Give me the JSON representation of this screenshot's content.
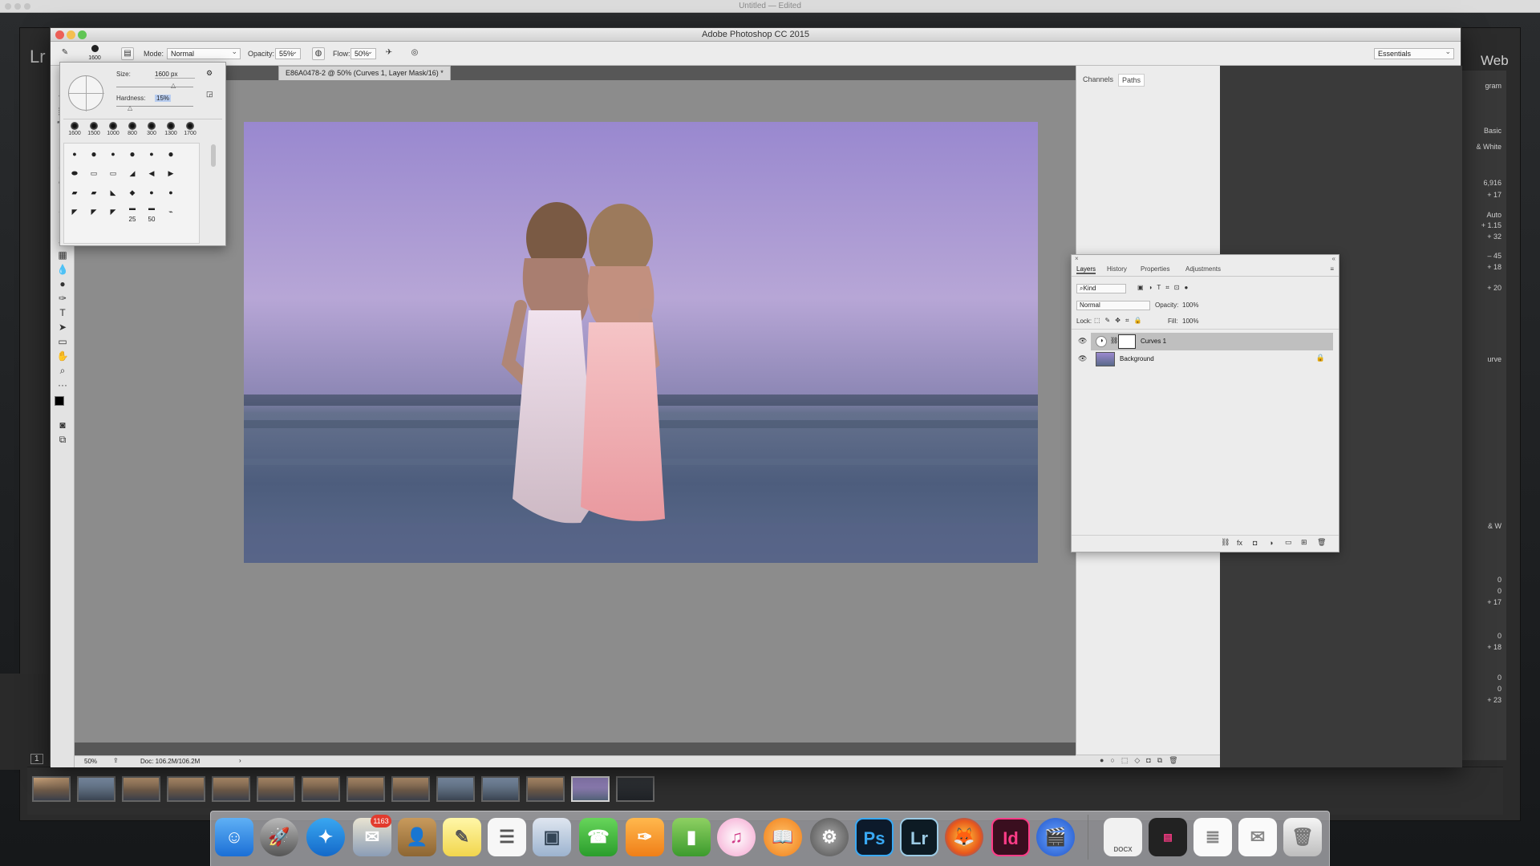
{
  "desktop": {
    "top_title": "Untitled — Edited"
  },
  "lightroom": {
    "logo": "Lr",
    "module_web": "Web",
    "right_values": [
      "6,916",
      "+ 17",
      "Auto",
      "+ 1.15",
      "+ 32",
      "– 45",
      "+ 18",
      "+ 20"
    ],
    "right_values_lower": [
      "0",
      "0",
      "+ 17",
      "0",
      "+ 18",
      "0",
      "0",
      "+ 23"
    ],
    "right_labels": [
      "gram",
      "Basic",
      "& White",
      "urve",
      "& W"
    ],
    "left_counter": "1"
  },
  "photoshop": {
    "window_title": "Adobe Photoshop CC 2015",
    "options": {
      "brush_size_label": "1600",
      "mode_label": "Mode:",
      "mode_value": "Normal",
      "opacity_label": "Opacity:",
      "opacity_value": "55%",
      "flow_label": "Flow:",
      "flow_value": "50%",
      "workspace_value": "Essentials"
    },
    "doc_tab": "E86A0478-2 @ 50% (Curves 1, Layer Mask/16) *",
    "status": {
      "zoom": "50%",
      "doc": "Doc: 106.2M/106.2M"
    },
    "right_dock_tabs": [
      "Channels",
      "Paths"
    ],
    "brush_picker": {
      "size_label": "Size:",
      "size_value": "1600 px",
      "hardness_label": "Hardness:",
      "hardness_value": "15%",
      "presets": [
        "1600",
        "1500",
        "1000",
        "800",
        "300",
        "1300",
        "1700"
      ],
      "grid_numbers": [
        "25",
        "50"
      ]
    },
    "layers_panel": {
      "tabs": [
        "Layers",
        "History",
        "Properties",
        "Adjustments"
      ],
      "kind_label": "Kind",
      "blend_mode": "Normal",
      "opacity_label": "Opacity:",
      "opacity_value": "100%",
      "lock_label": "Lock:",
      "fill_label": "Fill:",
      "fill_value": "100%",
      "layers": [
        {
          "name": "Curves 1",
          "selected": true
        },
        {
          "name": "Background",
          "selected": false
        }
      ]
    }
  },
  "dock": {
    "mail_badge": "1163",
    "apps": [
      "finder-icon",
      "launchpad-icon",
      "safari-icon",
      "mail-icon",
      "contacts-icon",
      "notes-icon",
      "reminders-icon",
      "preview-icon",
      "facetime-icon",
      "pages-icon",
      "numbers-icon",
      "itunes-icon",
      "ibooks-icon",
      "system-preferences-icon",
      "photoshop-icon",
      "lightroom-icon",
      "firefox-icon",
      "indesign-icon",
      "screen-capture-icon",
      "document-icon",
      "indesign-file-icon",
      "text-file-icon",
      "mail-file-icon",
      "trash-icon"
    ],
    "photoshop_label": "Ps",
    "lightroom_label": "Lr",
    "indesign_label": "Id",
    "docx_label": "DOCX"
  }
}
